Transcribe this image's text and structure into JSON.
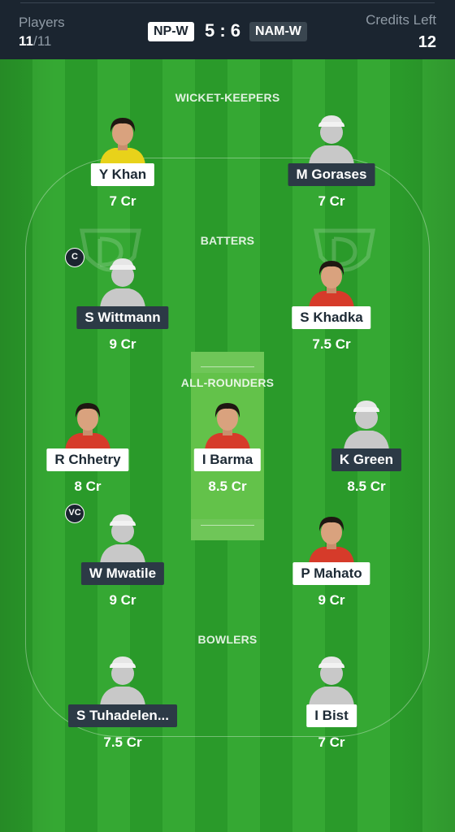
{
  "header": {
    "players_label": "Players",
    "players_selected": "11",
    "players_total": "/11",
    "team_a": "NP-W",
    "score": "5 : 6",
    "team_b": "NAM-W",
    "credits_label": "Credits Left",
    "credits_value": "12"
  },
  "sections": {
    "wicket_keepers": "WICKET-KEEPERS",
    "batters": "BATTERS",
    "all_rounders": "ALL-ROUNDERS",
    "bowlers": "BOWLERS"
  },
  "players": [
    {
      "name": "Y Khan",
      "credits": "7 Cr",
      "team": "NP-W",
      "role": "wicket-keeper",
      "photo": "photo",
      "jersey": "#e8d21a"
    },
    {
      "name": "M Gorases",
      "credits": "7 Cr",
      "team": "NAM-W",
      "role": "wicket-keeper",
      "photo": "placeholder"
    },
    {
      "name": "S Wittmann",
      "credits": "9 Cr",
      "team": "NAM-W",
      "role": "batter",
      "photo": "placeholder",
      "badge": "C"
    },
    {
      "name": "S Khadka",
      "credits": "7.5 Cr",
      "team": "NP-W",
      "role": "batter",
      "photo": "photo",
      "jersey": "#d63b2a"
    },
    {
      "name": "R Chhetry",
      "credits": "8 Cr",
      "team": "NP-W",
      "role": "all-rounder",
      "photo": "photo",
      "jersey": "#d63b2a"
    },
    {
      "name": "I Barma",
      "credits": "8.5 Cr",
      "team": "NP-W",
      "role": "all-rounder",
      "photo": "photo",
      "jersey": "#d63b2a"
    },
    {
      "name": "K Green",
      "credits": "8.5 Cr",
      "team": "NAM-W",
      "role": "all-rounder",
      "photo": "placeholder"
    },
    {
      "name": "W Mwatile",
      "credits": "9 Cr",
      "team": "NAM-W",
      "role": "all-rounder",
      "photo": "placeholder",
      "badge": "VC"
    },
    {
      "name": "P Mahato",
      "credits": "9 Cr",
      "team": "NP-W",
      "role": "all-rounder",
      "photo": "photo",
      "jersey": "#d63b2a"
    },
    {
      "name": "S Tuhadelen...",
      "credits": "7.5 Cr",
      "team": "NAM-W",
      "role": "bowler",
      "photo": "placeholder"
    },
    {
      "name": "I Bist",
      "credits": "7 Cr",
      "team": "NP-W",
      "role": "bowler",
      "photo": "placeholder"
    }
  ],
  "colors": {
    "header_bg": "#1b2530",
    "field_green": "#2a9a2a",
    "pitch": "#63c24a",
    "pill_dark": "#2c3a46",
    "pill_light": "#ffffff"
  }
}
